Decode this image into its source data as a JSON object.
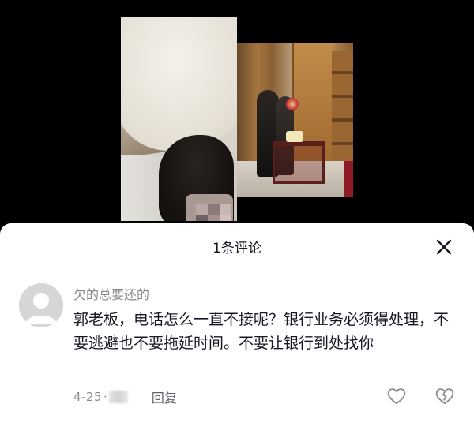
{
  "sheet": {
    "title": "1条评论",
    "close_icon": "close-icon"
  },
  "comment": {
    "username": "欠的总要还的",
    "text": "郭老板，电话怎么一直不接呢？银行业务必须得处理，不要逃避也不要拖延时间。不要让银行到处找你",
    "date": "4-25",
    "separator": "·",
    "reply_label": "回复",
    "like_icon": "heart-icon",
    "dislike_icon": "broken-heart-icon"
  },
  "colors": {
    "sheet_bg": "#ffffff",
    "primary_text": "#161823",
    "secondary_text": "#8a8b91",
    "avatar_bg": "#d6d6d6"
  }
}
